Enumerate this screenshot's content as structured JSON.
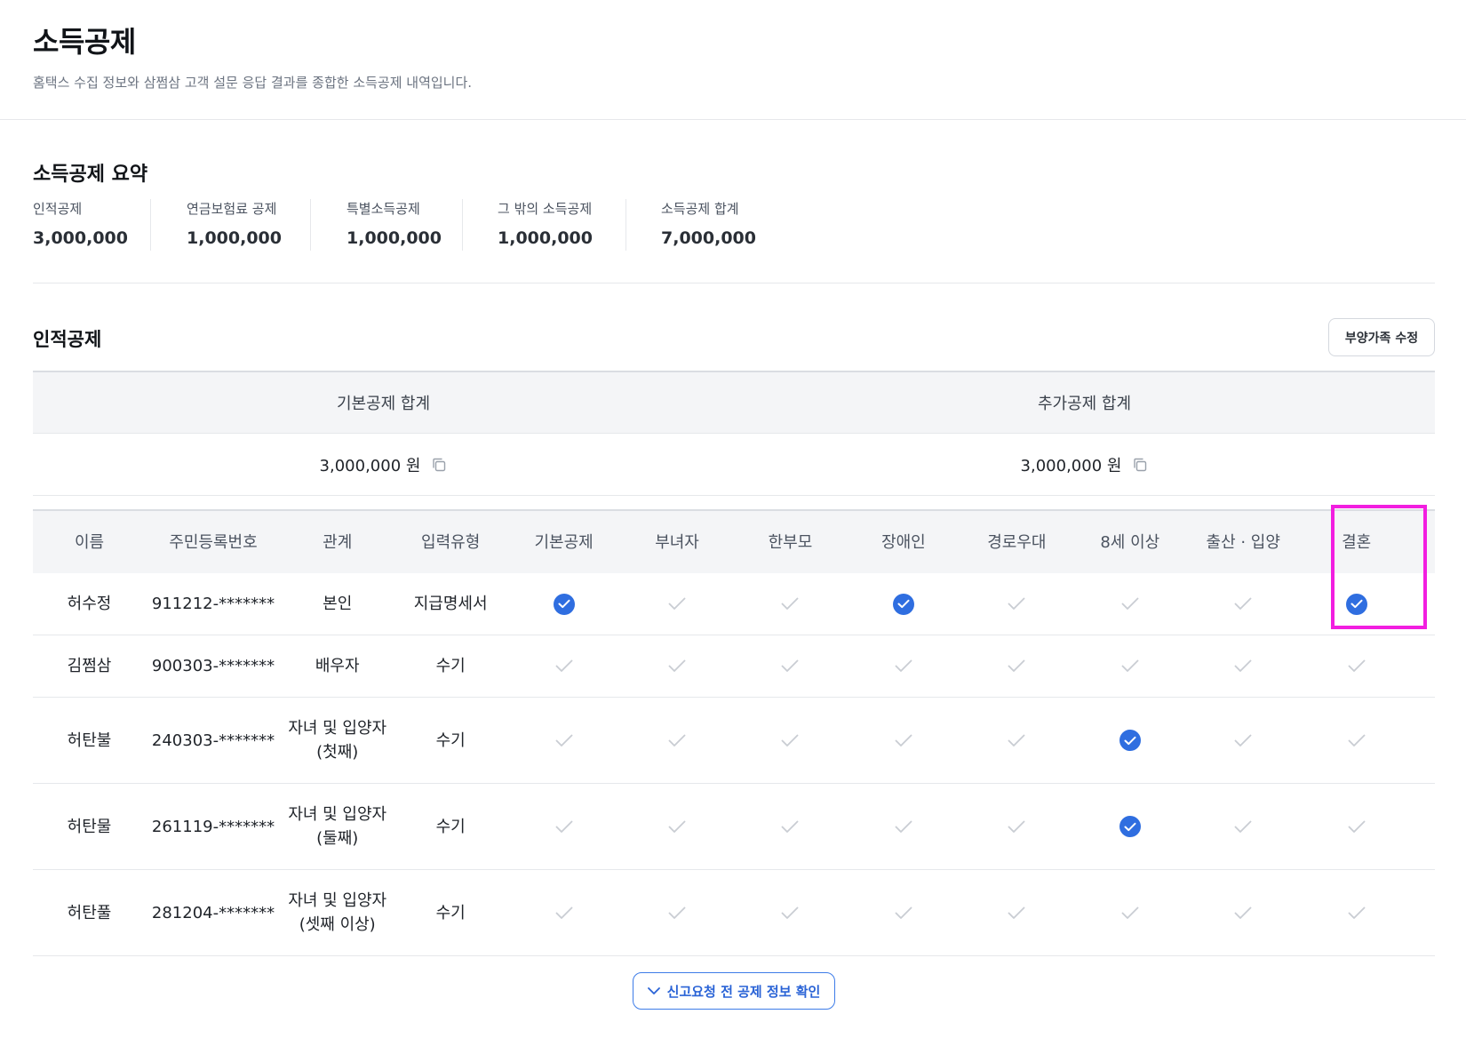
{
  "page": {
    "title": "소득공제",
    "subtitle": "홈택스 수집 정보와 삼쩜삼 고객 설문 응답 결과를 종합한 소득공제 내역입니다."
  },
  "summary": {
    "title": "소득공제 요약",
    "items": [
      {
        "label": "인적공제",
        "value": "3,000,000"
      },
      {
        "label": "연금보험료 공제",
        "value": "1,000,000"
      },
      {
        "label": "특별소득공제",
        "value": "1,000,000"
      },
      {
        "label": "그 밖의 소득공제",
        "value": "1,000,000"
      },
      {
        "label": "소득공제 합계",
        "value": "7,000,000"
      }
    ]
  },
  "personal": {
    "title": "인적공제",
    "edit_label": "부양가족 수정",
    "totals": {
      "basic_label": "기본공제 합계",
      "basic_value": "3,000,000 원",
      "additional_label": "추가공제 합계",
      "additional_value": "3,000,000 원"
    },
    "columns": [
      "이름",
      "주민등록번호",
      "관계",
      "입력유형",
      "기본공제",
      "부녀자",
      "한부모",
      "장애인",
      "경로우대",
      "8세 이상",
      "출산 · 입양",
      "결혼"
    ],
    "rows": [
      {
        "name": "허수정",
        "id": "911212-*******",
        "relation": [
          "본인"
        ],
        "type": "지급명세서",
        "checks": [
          true,
          false,
          false,
          true,
          false,
          false,
          false,
          true
        ]
      },
      {
        "name": "김쩜삼",
        "id": "900303-*******",
        "relation": [
          "배우자"
        ],
        "type": "수기",
        "checks": [
          false,
          false,
          false,
          false,
          false,
          false,
          false,
          false
        ]
      },
      {
        "name": "허탄불",
        "id": "240303-*******",
        "relation": [
          "자녀 및 입양자",
          "(첫째)"
        ],
        "type": "수기",
        "checks": [
          false,
          false,
          false,
          false,
          false,
          true,
          false,
          false
        ]
      },
      {
        "name": "허탄물",
        "id": "261119-*******",
        "relation": [
          "자녀 및 입양자",
          "(둘째)"
        ],
        "type": "수기",
        "checks": [
          false,
          false,
          false,
          false,
          false,
          true,
          false,
          false
        ]
      },
      {
        "name": "허탄풀",
        "id": "281204-*******",
        "relation": [
          "자녀 및 입양자",
          "(셋째 이상)"
        ],
        "type": "수기",
        "checks": [
          false,
          false,
          false,
          false,
          false,
          false,
          false,
          false
        ]
      }
    ],
    "expand_label": "신고요청 전 공제 정보 확인"
  },
  "colors": {
    "accent": "#2f6ee0",
    "check_off": "#c9cdd3",
    "highlight": "#f21ee0"
  },
  "icons": {
    "copy": "copy-icon",
    "check_on": "check-circle-filled-icon",
    "check_off": "check-outline-icon",
    "expand": "chevron-down-icon"
  }
}
